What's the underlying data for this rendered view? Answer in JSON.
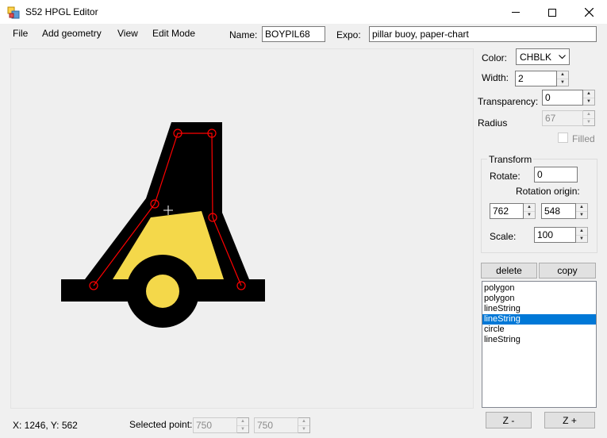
{
  "window": {
    "title": "S52 HPGL Editor",
    "minimize_glyph": "—",
    "maximize_glyph": "☐",
    "close_glyph": "✕"
  },
  "menu": {
    "file": "File",
    "add_geometry": "Add geometry",
    "view": "View",
    "edit_mode": "Edit Mode"
  },
  "header": {
    "name_label": "Name:",
    "name_value": "BOYPIL68",
    "expo_label": "Expo:",
    "expo_value": "pillar buoy, paper-chart"
  },
  "props": {
    "color_label": "Color:",
    "color_value": "CHBLK",
    "width_label": "Width:",
    "width_value": "2",
    "transparency_label": "Transparency:",
    "transparency_value": "0",
    "radius_label": "Radius",
    "radius_value": "67",
    "filled_label": "Filled"
  },
  "transform": {
    "legend": "Transform",
    "rotate_label": "Rotate:",
    "rotate_value": "0",
    "origin_label": "Rotation origin:",
    "origin_x": "762",
    "origin_y": "548",
    "scale_label": "Scale:",
    "scale_value": "100"
  },
  "actions": {
    "delete_label": "delete",
    "copy_label": "copy",
    "z_minus_label": "Z -",
    "z_plus_label": "Z +"
  },
  "geometry_list": [
    "polygon",
    "polygon",
    "lineString",
    "lineString",
    "circle",
    "lineString"
  ],
  "geometry_selected_index": 3,
  "status": {
    "coords": "X: 1246, Y: 562",
    "selected_point_label": "Selected point:",
    "point_x": "750",
    "point_y": "750"
  },
  "colors": {
    "symbol_black": "#000000",
    "symbol_yellow": "#f4d84a",
    "edit_line": "#ff0000",
    "selection": "#0078d7"
  }
}
